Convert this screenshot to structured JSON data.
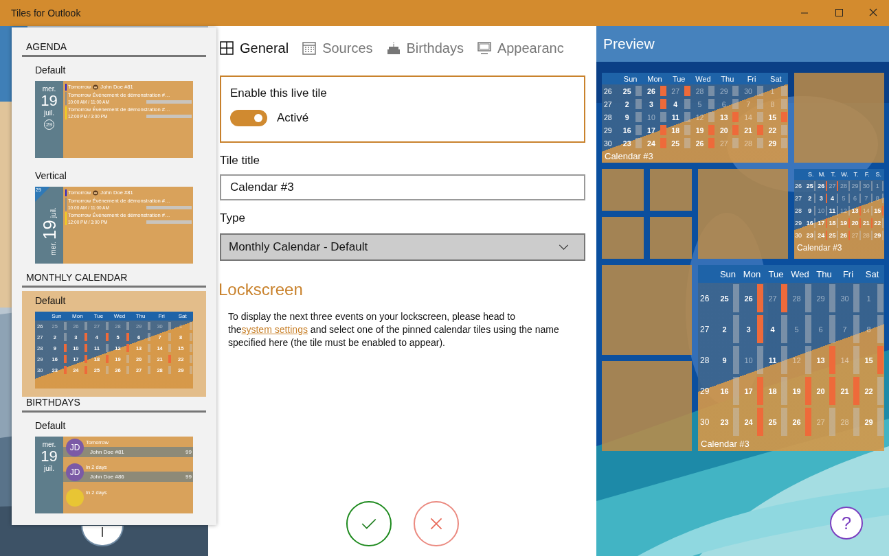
{
  "window": {
    "title": "Tiles for Outlook"
  },
  "tile_types": {
    "sections": [
      {
        "heading": "AGENDA",
        "items": [
          {
            "label": "Default",
            "selected": false,
            "preview": {
              "kind": "agenda",
              "weekday": "mer.",
              "day": "19",
              "month": "juil.",
              "week": "29",
              "events": [
                {
                  "kind": "birthday",
                  "title": "Tomorrow",
                  "subtitle": "John Doe #81",
                  "color": "#2b22c8"
                },
                {
                  "kind": "event",
                  "title": "Tomorrow Événement de démonstration #…",
                  "time": "10:00 AM / 11:00 AM",
                  "color": "#8c8c8c"
                },
                {
                  "kind": "event",
                  "title": "Tomorrow Événement de démonstration #…",
                  "time": "12:00 PM / 3:00 PM",
                  "color": "#f2d21c"
                }
              ]
            }
          },
          {
            "label": "Vertical",
            "selected": false,
            "preview": {
              "kind": "agenda-vertical",
              "weekday": "mer.",
              "day": "19",
              "month": "juil.",
              "week": "29",
              "events": [
                {
                  "kind": "birthday",
                  "title": "Tomorrow",
                  "subtitle": "John Doe #81",
                  "color": "#2b22c8"
                },
                {
                  "kind": "event",
                  "title": "Tomorrow Événement de démonstration #…",
                  "time": "10:00 AM / 11:00 AM",
                  "color": "#8c8c8c"
                },
                {
                  "kind": "event",
                  "title": "Tomorrow Événement de démonstration #…",
                  "time": "12:00 PM / 3:00 PM",
                  "color": "#f2d21c"
                }
              ]
            }
          }
        ]
      },
      {
        "heading": "MONTHLY CALENDAR",
        "items": [
          {
            "label": "Default",
            "selected": true,
            "preview": {
              "kind": "calendar",
              "calendar": {
                "headers": [
                  "Sun",
                  "Mon",
                  "Tue",
                  "Wed",
                  "Thu",
                  "Fri",
                  "Sat"
                ],
                "weeks": [
                  {
                    "number": "26",
                    "days": [
                      {
                        "label": "25",
                        "dim": true,
                        "event": false
                      },
                      {
                        "label": "26",
                        "dim": true,
                        "event": false
                      },
                      {
                        "label": "27",
                        "dim": true,
                        "event": false
                      },
                      {
                        "label": "28",
                        "dim": true,
                        "event": false
                      },
                      {
                        "label": "29",
                        "dim": true,
                        "event": false
                      },
                      {
                        "label": "30",
                        "dim": true,
                        "event": false
                      },
                      {
                        "label": "1",
                        "dim": true,
                        "event": false
                      }
                    ]
                  },
                  {
                    "number": "27",
                    "days": [
                      {
                        "label": "2",
                        "dim": false,
                        "event": false
                      },
                      {
                        "label": "3",
                        "dim": false,
                        "event": true
                      },
                      {
                        "label": "4",
                        "dim": false,
                        "event": true
                      },
                      {
                        "label": "5",
                        "dim": false,
                        "event": true
                      },
                      {
                        "label": "6",
                        "dim": false,
                        "event": false
                      },
                      {
                        "label": "7",
                        "dim": false,
                        "event": false
                      },
                      {
                        "label": "8",
                        "dim": false,
                        "event": false
                      }
                    ]
                  },
                  {
                    "number": "28",
                    "days": [
                      {
                        "label": "9",
                        "dim": false,
                        "event": true
                      },
                      {
                        "label": "10",
                        "dim": false,
                        "event": true
                      },
                      {
                        "label": "11",
                        "dim": false,
                        "event": false
                      },
                      {
                        "label": "12",
                        "dim": false,
                        "event": true
                      },
                      {
                        "label": "13",
                        "dim": false,
                        "event": false
                      },
                      {
                        "label": "14",
                        "dim": false,
                        "event": false
                      },
                      {
                        "label": "15",
                        "dim": false,
                        "event": false
                      }
                    ]
                  },
                  {
                    "number": "29",
                    "days": [
                      {
                        "label": "16",
                        "dim": false,
                        "event": true
                      },
                      {
                        "label": "17",
                        "dim": false,
                        "event": true
                      },
                      {
                        "label": "18",
                        "dim": false,
                        "event": true
                      },
                      {
                        "label": "19",
                        "dim": false,
                        "event": false
                      },
                      {
                        "label": "20",
                        "dim": false,
                        "event": false
                      },
                      {
                        "label": "21",
                        "dim": false,
                        "event": true
                      },
                      {
                        "label": "22",
                        "dim": false,
                        "event": false
                      }
                    ]
                  },
                  {
                    "number": "30",
                    "days": [
                      {
                        "label": "23",
                        "dim": false,
                        "event": true
                      },
                      {
                        "label": "24",
                        "dim": false,
                        "event": true
                      },
                      {
                        "label": "25",
                        "dim": false,
                        "event": false
                      },
                      {
                        "label": "26",
                        "dim": false,
                        "event": false
                      },
                      {
                        "label": "27",
                        "dim": false,
                        "event": false
                      },
                      {
                        "label": "28",
                        "dim": false,
                        "event": false
                      },
                      {
                        "label": "29",
                        "dim": false,
                        "event": false
                      }
                    ]
                  }
                ]
              }
            }
          }
        ]
      },
      {
        "heading": "BIRTHDAYS",
        "items": [
          {
            "label": "Default",
            "selected": false,
            "preview": {
              "kind": "birthdays",
              "weekday": "mer.",
              "day": "19",
              "month": "juil.",
              "people": [
                {
                  "initials": "JD",
                  "when": "Tomorrow",
                  "name": "John Doe #81",
                  "age": "99",
                  "color": "#7b5aa6"
                },
                {
                  "initials": "JD",
                  "when": "In 2 days",
                  "name": "John Doe #86",
                  "age": "99",
                  "color": "#7b5aa6"
                },
                {
                  "when": "In 2 days",
                  "color": "#e8c534"
                }
              ]
            }
          }
        ]
      }
    ]
  },
  "tabs": [
    {
      "label": "General",
      "selected": true
    },
    {
      "label": "Sources",
      "selected": false
    },
    {
      "label": "Birthdays",
      "selected": false
    },
    {
      "label": "Appearanc",
      "selected": false
    }
  ],
  "general": {
    "enable_label": "Enable this live tile",
    "enabled": {
      "on": true,
      "label": "Activé"
    },
    "tile_title": {
      "label": "Tile title",
      "value": "Calendar #3"
    },
    "type": {
      "label": "Type",
      "value": "Monthly Calendar - Default"
    }
  },
  "lockscreen": {
    "heading": "Lockscreen",
    "text_before": "To display the next three events on your lockscreen, please head to the",
    "link": "system settings",
    "text_after": " and select one of the pinned calendar tiles using the name specified here (the tile must be enabled to appear)."
  },
  "preview": {
    "title": "Preview",
    "help": "?",
    "tiles": [
      {
        "kind": "wide-calendar",
        "calendar": {
          "title": "Calendar #3",
          "headers": [
            "Sun",
            "Mon",
            "Tue",
            "Wed",
            "Thu",
            "Fri",
            "Sat"
          ],
          "weeks": [
            {
              "number": "26",
              "days": [
                {
                  "label": "25",
                  "dim": false,
                  "event": false
                },
                {
                  "label": "26",
                  "dim": false,
                  "event": true
                },
                {
                  "label": "27",
                  "dim": true,
                  "event": true
                },
                {
                  "label": "28",
                  "dim": true,
                  "event": false
                },
                {
                  "label": "29",
                  "dim": true,
                  "event": false
                },
                {
                  "label": "30",
                  "dim": true,
                  "event": false
                },
                {
                  "label": "1",
                  "dim": true,
                  "event": false
                }
              ]
            },
            {
              "number": "27",
              "days": [
                {
                  "label": "2",
                  "dim": false,
                  "event": false
                },
                {
                  "label": "3",
                  "dim": false,
                  "event": true
                },
                {
                  "label": "4",
                  "dim": false,
                  "event": false
                },
                {
                  "label": "5",
                  "dim": true,
                  "event": false
                },
                {
                  "label": "6",
                  "dim": true,
                  "event": false
                },
                {
                  "label": "7",
                  "dim": true,
                  "event": false
                },
                {
                  "label": "8",
                  "dim": true,
                  "event": false
                }
              ]
            },
            {
              "number": "28",
              "days": [
                {
                  "label": "9",
                  "dim": false,
                  "event": false
                },
                {
                  "label": "10",
                  "dim": true,
                  "event": false
                },
                {
                  "label": "11",
                  "dim": false,
                  "event": false
                },
                {
                  "label": "12",
                  "dim": true,
                  "event": false
                },
                {
                  "label": "13",
                  "dim": false,
                  "event": true
                },
                {
                  "label": "14",
                  "dim": true,
                  "event": false
                },
                {
                  "label": "15",
                  "dim": false,
                  "event": true
                }
              ]
            },
            {
              "number": "29",
              "days": [
                {
                  "label": "16",
                  "dim": false,
                  "event": false
                },
                {
                  "label": "17",
                  "dim": false,
                  "event": true
                },
                {
                  "label": "18",
                  "dim": false,
                  "event": false
                },
                {
                  "label": "19",
                  "dim": false,
                  "event": true
                },
                {
                  "label": "20",
                  "dim": false,
                  "event": true
                },
                {
                  "label": "21",
                  "dim": false,
                  "event": true
                },
                {
                  "label": "22",
                  "dim": false,
                  "event": false
                }
              ]
            },
            {
              "number": "30",
              "days": [
                {
                  "label": "23",
                  "dim": false,
                  "event": false
                },
                {
                  "label": "24",
                  "dim": false,
                  "event": true
                },
                {
                  "label": "25",
                  "dim": false,
                  "event": false
                },
                {
                  "label": "26",
                  "dim": false,
                  "event": true
                },
                {
                  "label": "27",
                  "dim": true,
                  "event": false
                },
                {
                  "label": "28",
                  "dim": true,
                  "event": false
                },
                {
                  "label": "29",
                  "dim": false,
                  "event": false
                }
              ]
            }
          ]
        }
      },
      {
        "kind": "medium-blank"
      },
      {
        "kind": "small-blank"
      },
      {
        "kind": "small-blank"
      },
      {
        "kind": "medium-blank"
      },
      {
        "kind": "medium-calendar",
        "calendar": {
          "title": "Calendar #3",
          "headers": [
            "S.",
            "M.",
            "T.",
            "W.",
            "T.",
            "F.",
            "S."
          ],
          "weeks": [
            {
              "number": "26",
              "days": [
                {
                  "label": "25",
                  "dim": false,
                  "event": false
                },
                {
                  "label": "26",
                  "dim": false,
                  "event": true
                },
                {
                  "label": "27",
                  "dim": true,
                  "event": true
                },
                {
                  "label": "28",
                  "dim": true,
                  "event": false
                },
                {
                  "label": "29",
                  "dim": true,
                  "event": false
                },
                {
                  "label": "30",
                  "dim": true,
                  "event": false
                },
                {
                  "label": "1",
                  "dim": true,
                  "event": false
                }
              ]
            },
            {
              "number": "27",
              "days": [
                {
                  "label": "2",
                  "dim": false,
                  "event": false
                },
                {
                  "label": "3",
                  "dim": false,
                  "event": true
                },
                {
                  "label": "4",
                  "dim": false,
                  "event": false
                },
                {
                  "label": "5",
                  "dim": true,
                  "event": false
                },
                {
                  "label": "6",
                  "dim": true,
                  "event": false
                },
                {
                  "label": "7",
                  "dim": true,
                  "event": false
                },
                {
                  "label": "8",
                  "dim": true,
                  "event": false
                }
              ]
            },
            {
              "number": "28",
              "days": [
                {
                  "label": "9",
                  "dim": false,
                  "event": false
                },
                {
                  "label": "10",
                  "dim": true,
                  "event": false
                },
                {
                  "label": "11",
                  "dim": false,
                  "event": false
                },
                {
                  "label": "12",
                  "dim": true,
                  "event": false
                },
                {
                  "label": "13",
                  "dim": false,
                  "event": true
                },
                {
                  "label": "14",
                  "dim": true,
                  "event": false
                },
                {
                  "label": "15",
                  "dim": false,
                  "event": true
                }
              ]
            },
            {
              "number": "29",
              "days": [
                {
                  "label": "16",
                  "dim": false,
                  "event": false
                },
                {
                  "label": "17",
                  "dim": false,
                  "event": true
                },
                {
                  "label": "18",
                  "dim": false,
                  "event": false
                },
                {
                  "label": "19",
                  "dim": false,
                  "event": true
                },
                {
                  "label": "20",
                  "dim": false,
                  "event": true
                },
                {
                  "label": "21",
                  "dim": false,
                  "event": true
                },
                {
                  "label": "22",
                  "dim": false,
                  "event": false
                }
              ]
            },
            {
              "number": "30",
              "days": [
                {
                  "label": "23",
                  "dim": false,
                  "event": false
                },
                {
                  "label": "24",
                  "dim": false,
                  "event": true
                },
                {
                  "label": "25",
                  "dim": false,
                  "event": false
                },
                {
                  "label": "26",
                  "dim": false,
                  "event": true
                },
                {
                  "label": "27",
                  "dim": true,
                  "event": false
                },
                {
                  "label": "28",
                  "dim": true,
                  "event": false
                },
                {
                  "label": "29",
                  "dim": false,
                  "event": false
                }
              ]
            }
          ]
        }
      },
      {
        "kind": "small-blank"
      },
      {
        "kind": "small-blank"
      },
      {
        "kind": "medium-blank"
      },
      {
        "kind": "large-calendar",
        "calendar": {
          "title": "Calendar #3",
          "headers": [
            "Sun",
            "Mon",
            "Tue",
            "Wed",
            "Thu",
            "Fri",
            "Sat"
          ],
          "weeks": [
            {
              "number": "26",
              "days": [
                {
                  "label": "25",
                  "dim": false,
                  "event": false
                },
                {
                  "label": "26",
                  "dim": false,
                  "event": true
                },
                {
                  "label": "27",
                  "dim": true,
                  "event": true
                },
                {
                  "label": "28",
                  "dim": true,
                  "event": false
                },
                {
                  "label": "29",
                  "dim": true,
                  "event": false
                },
                {
                  "label": "30",
                  "dim": true,
                  "event": false
                },
                {
                  "label": "1",
                  "dim": true,
                  "event": false
                }
              ]
            },
            {
              "number": "27",
              "days": [
                {
                  "label": "2",
                  "dim": false,
                  "event": false
                },
                {
                  "label": "3",
                  "dim": false,
                  "event": true
                },
                {
                  "label": "4",
                  "dim": false,
                  "event": false
                },
                {
                  "label": "5",
                  "dim": true,
                  "event": false
                },
                {
                  "label": "6",
                  "dim": true,
                  "event": false
                },
                {
                  "label": "7",
                  "dim": true,
                  "event": false
                },
                {
                  "label": "8",
                  "dim": true,
                  "event": false
                }
              ]
            },
            {
              "number": "28",
              "days": [
                {
                  "label": "9",
                  "dim": false,
                  "event": false
                },
                {
                  "label": "10",
                  "dim": true,
                  "event": false
                },
                {
                  "label": "11",
                  "dim": false,
                  "event": false
                },
                {
                  "label": "12",
                  "dim": true,
                  "event": false
                },
                {
                  "label": "13",
                  "dim": false,
                  "event": true
                },
                {
                  "label": "14",
                  "dim": true,
                  "event": false
                },
                {
                  "label": "15",
                  "dim": false,
                  "event": true
                }
              ]
            },
            {
              "number": "29",
              "days": [
                {
                  "label": "16",
                  "dim": false,
                  "event": false
                },
                {
                  "label": "17",
                  "dim": false,
                  "event": true
                },
                {
                  "label": "18",
                  "dim": false,
                  "event": false
                },
                {
                  "label": "19",
                  "dim": false,
                  "event": true
                },
                {
                  "label": "20",
                  "dim": false,
                  "event": true
                },
                {
                  "label": "21",
                  "dim": false,
                  "event": true
                },
                {
                  "label": "22",
                  "dim": false,
                  "event": false
                }
              ]
            },
            {
              "number": "30",
              "days": [
                {
                  "label": "23",
                  "dim": false,
                  "event": false
                },
                {
                  "label": "24",
                  "dim": false,
                  "event": true
                },
                {
                  "label": "25",
                  "dim": false,
                  "event": false
                },
                {
                  "label": "26",
                  "dim": false,
                  "event": true
                },
                {
                  "label": "27",
                  "dim": true,
                  "event": false
                },
                {
                  "label": "28",
                  "dim": true,
                  "event": false
                },
                {
                  "label": "29",
                  "dim": false,
                  "event": false
                }
              ]
            }
          ]
        }
      },
      {
        "kind": "medium-blank"
      }
    ]
  }
}
